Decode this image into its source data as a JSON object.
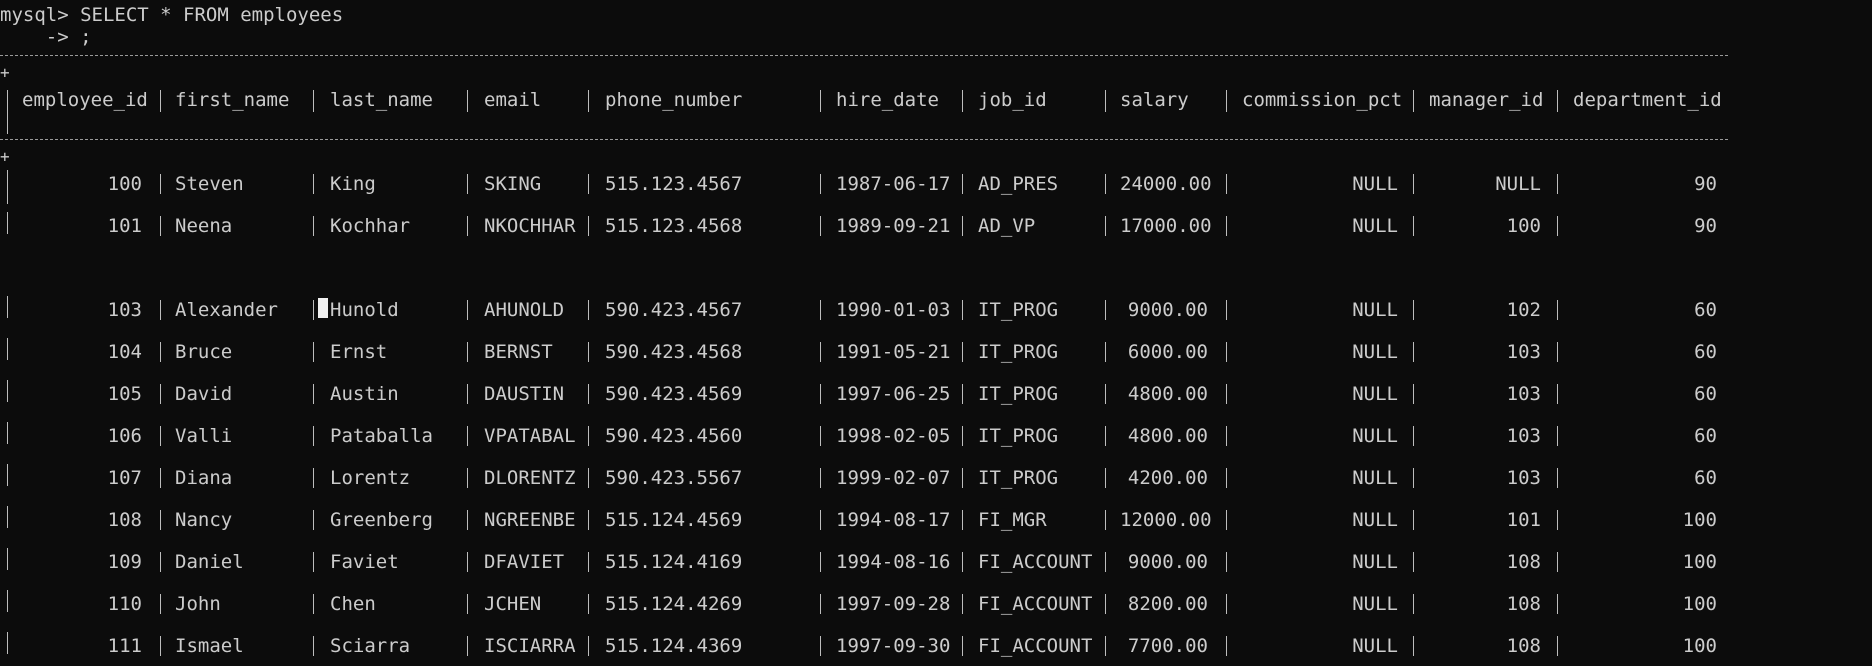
{
  "prompt_line": "mysql> SELECT * FROM employees",
  "continuation_line": "    -> ;",
  "columns": [
    "employee_id",
    "first_name",
    "last_name",
    "email",
    "phone_number",
    "hire_date",
    "job_id",
    "salary",
    "commission_pct",
    "manager_id",
    "department_id"
  ],
  "rows": [
    [
      "100",
      "Steven",
      "King",
      "SKING",
      "515.123.4567",
      "1987-06-17",
      "AD_PRES",
      "24000.00",
      "NULL",
      "NULL",
      "90"
    ],
    [
      "101",
      "Neena",
      "Kochhar",
      "NKOCHHAR",
      "515.123.4568",
      "1989-09-21",
      "AD_VP",
      "17000.00",
      "NULL",
      "100",
      "90"
    ],
    [
      "103",
      "Alexander",
      "Hunold",
      "AHUNOLD",
      "590.423.4567",
      "1990-01-03",
      "IT_PROG",
      "9000.00",
      "NULL",
      "102",
      "60"
    ],
    [
      "104",
      "Bruce",
      "Ernst",
      "BERNST",
      "590.423.4568",
      "1991-05-21",
      "IT_PROG",
      "6000.00",
      "NULL",
      "103",
      "60"
    ],
    [
      "105",
      "David",
      "Austin",
      "DAUSTIN",
      "590.423.4569",
      "1997-06-25",
      "IT_PROG",
      "4800.00",
      "NULL",
      "103",
      "60"
    ],
    [
      "106",
      "Valli",
      "Pataballa",
      "VPATABAL",
      "590.423.4560",
      "1998-02-05",
      "IT_PROG",
      "4800.00",
      "NULL",
      "103",
      "60"
    ],
    [
      "107",
      "Diana",
      "Lorentz",
      "DLORENTZ",
      "590.423.5567",
      "1999-02-07",
      "IT_PROG",
      "4200.00",
      "NULL",
      "103",
      "60"
    ],
    [
      "108",
      "Nancy",
      "Greenberg",
      "NGREENBE",
      "515.124.4569",
      "1994-08-17",
      "FI_MGR",
      "12000.00",
      "NULL",
      "101",
      "100"
    ],
    [
      "109",
      "Daniel",
      "Faviet",
      "DFAVIET",
      "515.124.4169",
      "1994-08-16",
      "FI_ACCOUNT",
      "9000.00",
      "NULL",
      "108",
      "100"
    ],
    [
      "110",
      "John",
      "Chen",
      "JCHEN",
      "515.124.4269",
      "1997-09-28",
      "FI_ACCOUNT",
      "8200.00",
      "NULL",
      "108",
      "100"
    ],
    [
      "111",
      "Ismael",
      "Sciarra",
      "ISCIARRA",
      "515.124.4369",
      "1997-09-30",
      "FI_ACCOUNT",
      "7700.00",
      "NULL",
      "108",
      "100"
    ]
  ],
  "plus_sign": "+"
}
